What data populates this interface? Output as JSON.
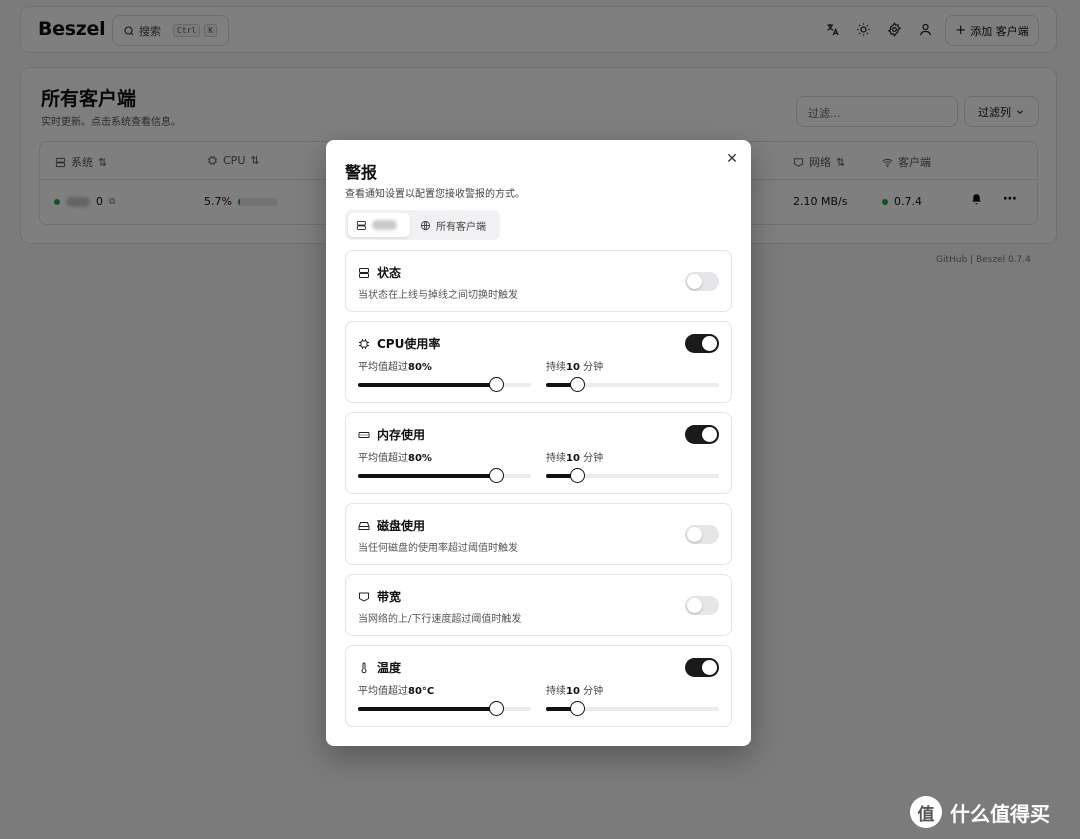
{
  "app": {
    "logo": "Beszel"
  },
  "header": {
    "search_label": "搜索",
    "kbd_ctrl": "Ctrl",
    "kbd_k": "K",
    "add_client_label": "添加 客户端"
  },
  "main": {
    "title": "所有客户端",
    "subtitle": "实时更新。点击系统查看信息。",
    "filter_placeholder": "过滤...",
    "filter_columns_label": "过滤列",
    "columns": {
      "system": "系统",
      "cpu": "CPU",
      "network": "网络",
      "client": "客户端"
    },
    "row": {
      "system_suffix": "0",
      "cpu": "5.7%",
      "cpu_fraction": 0.06,
      "network": "2.10 MB/s",
      "client_version": "0.7.4"
    }
  },
  "footer": {
    "text": "GitHub | Beszel 0.7.4"
  },
  "modal": {
    "title": "警报",
    "description": "查看通知设置以配置您接收警报的方式。",
    "tabs": [
      {
        "label": ""
      },
      {
        "label": "所有客户端"
      }
    ],
    "alerts": [
      {
        "title": "状态",
        "description": "当状态在上线与掉线之间切换时触发",
        "enabled": false
      },
      {
        "title": "CPU使用率",
        "enabled": true,
        "threshold_prefix": "平均值超过",
        "threshold_value": "80%",
        "threshold_fraction": 0.8,
        "duration_prefix": "持续",
        "duration_value": "10",
        "duration_unit": " 分钟",
        "duration_fraction": 0.18
      },
      {
        "title": "内存使用",
        "enabled": true,
        "threshold_prefix": "平均值超过",
        "threshold_value": "80%",
        "threshold_fraction": 0.8,
        "duration_prefix": "持续",
        "duration_value": "10",
        "duration_unit": " 分钟",
        "duration_fraction": 0.18
      },
      {
        "title": "磁盘使用",
        "description": "当任何磁盘的使用率超过阈值时触发",
        "enabled": false
      },
      {
        "title": "带宽",
        "description": "当网络的上/下行速度超过阈值时触发",
        "enabled": false
      },
      {
        "title": "温度",
        "enabled": true,
        "threshold_prefix": "平均值超过",
        "threshold_value": "80°C",
        "threshold_fraction": 0.8,
        "duration_prefix": "持续",
        "duration_value": "10",
        "duration_unit": " 分钟",
        "duration_fraction": 0.18
      }
    ]
  },
  "watermark": {
    "text": "什么值得买",
    "glyph": "值"
  }
}
